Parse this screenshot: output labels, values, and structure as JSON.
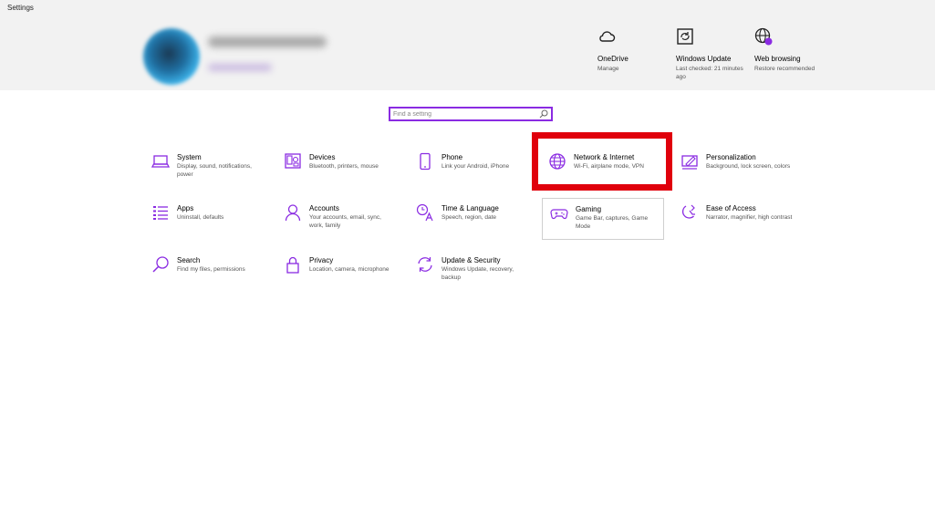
{
  "window": {
    "title": "Settings"
  },
  "header": {
    "quick_links": [
      {
        "title": "OneDrive",
        "sub": "Manage",
        "icon": "cloud-icon"
      },
      {
        "title": "Windows Update",
        "sub": "Last checked: 21 minutes ago",
        "icon": "windows-update-icon"
      },
      {
        "title": "Web browsing",
        "sub": "Restore recommended",
        "icon": "globe-icon"
      }
    ]
  },
  "search": {
    "placeholder": "Find a setting",
    "icon": "search-icon"
  },
  "tiles": [
    {
      "title": "System",
      "desc": "Display, sound, notifications, power",
      "icon": "laptop-icon"
    },
    {
      "title": "Devices",
      "desc": "Bluetooth, printers, mouse",
      "icon": "devices-icon"
    },
    {
      "title": "Phone",
      "desc": "Link your Android, iPhone",
      "icon": "phone-icon"
    },
    {
      "title": "Network & Internet",
      "desc": "Wi-Fi, airplane mode, VPN",
      "icon": "globe-icon"
    },
    {
      "title": "Personalization",
      "desc": "Background, lock screen, colors",
      "icon": "paint-icon"
    },
    {
      "title": "Apps",
      "desc": "Uninstall, defaults",
      "icon": "apps-list-icon"
    },
    {
      "title": "Accounts",
      "desc": "Your accounts, email, sync, work, family",
      "icon": "person-icon"
    },
    {
      "title": "Time & Language",
      "desc": "Speech, region, date",
      "icon": "time-language-icon"
    },
    {
      "title": "Gaming",
      "desc": "Game Bar, captures, Game Mode",
      "icon": "gamepad-icon"
    },
    {
      "title": "Ease of Access",
      "desc": "Narrator, magnifier, high contrast",
      "icon": "ease-of-access-icon"
    },
    {
      "title": "Search",
      "desc": "Find my files, permissions",
      "icon": "search-icon"
    },
    {
      "title": "Privacy",
      "desc": "Location, camera, microphone",
      "icon": "lock-icon"
    },
    {
      "title": "Update & Security",
      "desc": "Windows Update, recovery, backup",
      "icon": "sync-icon"
    }
  ],
  "colors": {
    "accent": "#8a2be2",
    "highlight": "#e0000c",
    "header_bg": "#f2f2f2"
  }
}
